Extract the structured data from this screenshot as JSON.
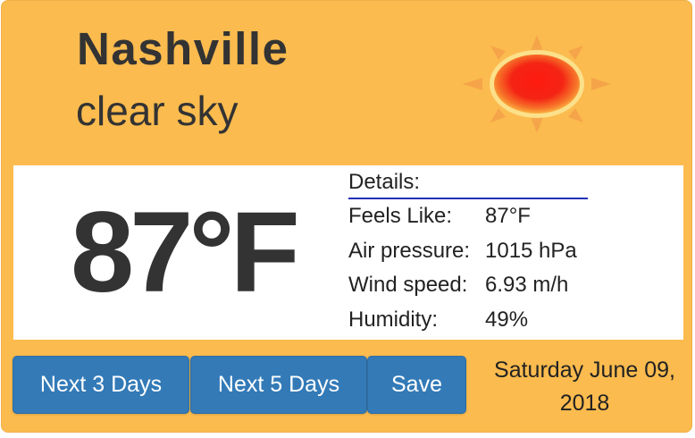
{
  "weather": {
    "city": "Nashville",
    "description": "clear sky",
    "icon": "sun-icon",
    "temperature": "87°F"
  },
  "details": {
    "title": "Details:",
    "rows": [
      {
        "label": "Feels Like:",
        "value": "87°F"
      },
      {
        "label": "Air pressure:",
        "value": "1015 hPa"
      },
      {
        "label": "Wind speed:",
        "value": "6.93 m/h"
      },
      {
        "label": "Humidity:",
        "value": "49%"
      }
    ]
  },
  "buttons": {
    "next3": "Next 3 Days",
    "next5": "Next 5 Days",
    "save": "Save"
  },
  "date": {
    "line1": "Saturday June 09,",
    "line2": "2018"
  },
  "colors": {
    "card_background": "#fbbb4e",
    "button_primary": "#337ab7",
    "details_underline": "#2330b8",
    "sun_core": "#f01818",
    "sun_rays": "#f5a24a"
  }
}
